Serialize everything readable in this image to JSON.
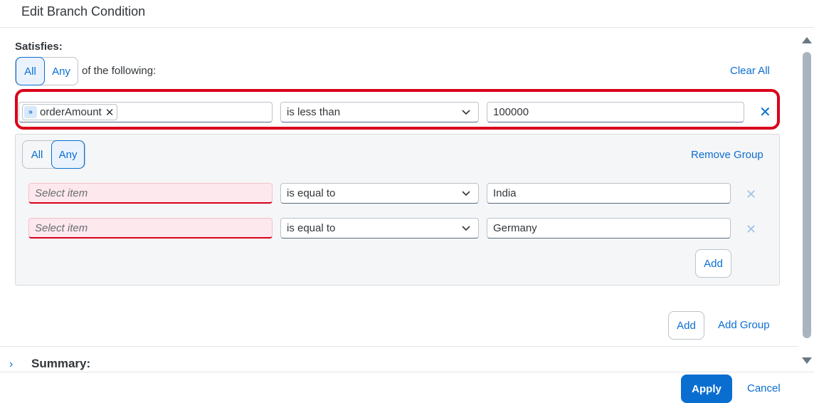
{
  "dialog": {
    "title": "Edit Branch Condition"
  },
  "main": {
    "satisfies_label": "Satisfies:",
    "match": {
      "options": [
        "All",
        "Any"
      ],
      "selected": "All"
    },
    "of_following": "of the following:",
    "clear_all": "Clear All",
    "condition": {
      "field_token": "orderAmount",
      "operator": "is less than",
      "value": "100000"
    },
    "group": {
      "match": {
        "options": [
          "All",
          "Any"
        ],
        "selected": "Any"
      },
      "remove_group": "Remove Group",
      "rows": [
        {
          "field_placeholder": "Select item",
          "operator": "is equal to",
          "value": "India"
        },
        {
          "field_placeholder": "Select item",
          "operator": "is equal to",
          "value": "Germany"
        }
      ],
      "add_label": "Add"
    },
    "add_label": "Add",
    "add_group_label": "Add Group"
  },
  "summary": {
    "label": "Summary:"
  },
  "footer": {
    "apply": "Apply",
    "cancel": "Cancel"
  },
  "colors": {
    "accent": "#0a6ed1",
    "error": "#d9001b",
    "highlight": "#d9001b"
  },
  "icons": [
    "remove-token-icon",
    "chevron-down-icon",
    "close-icon",
    "chevron-right-icon",
    "field-type-icon"
  ]
}
